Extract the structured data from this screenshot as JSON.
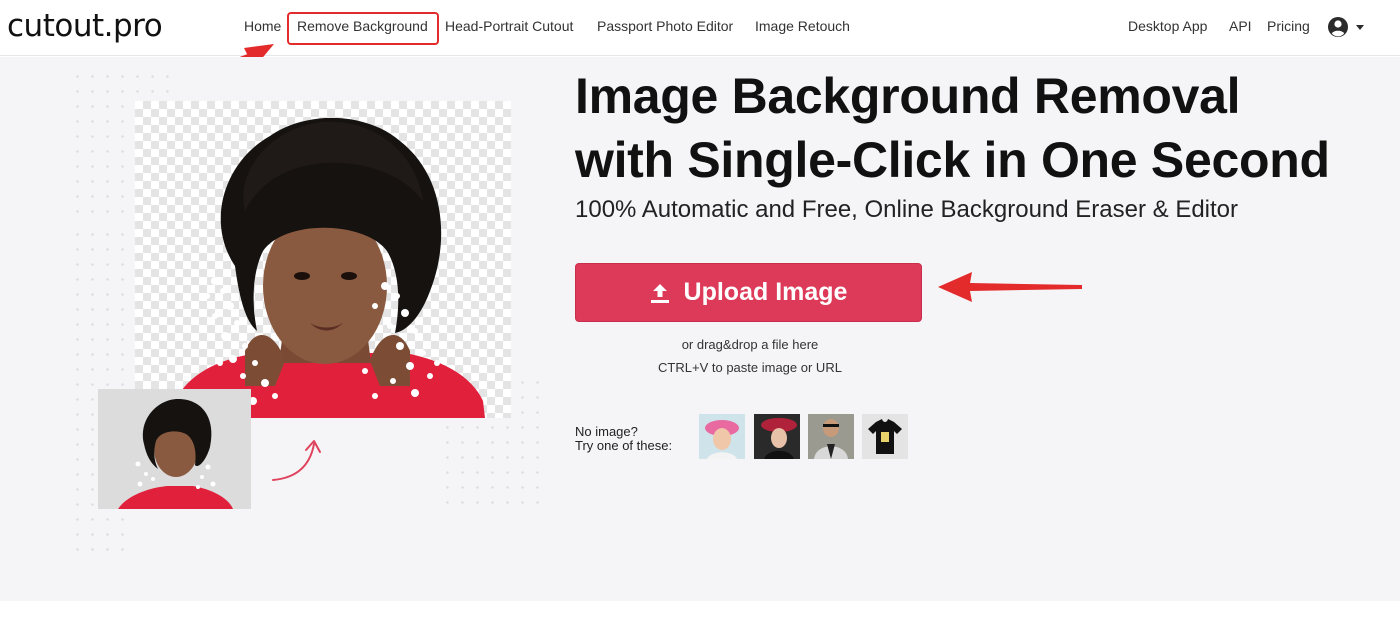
{
  "brand": {
    "logo": "cutout.pro"
  },
  "nav": {
    "links": [
      "Home",
      "Remove Background",
      "Head-Portrait Cutout",
      "Passport Photo Editor",
      "Image Retouch"
    ],
    "right": [
      "Desktop App",
      "API",
      "Pricing"
    ],
    "account_icon": "user-circle-icon",
    "dropdown_icon": "caret-down-icon"
  },
  "hero": {
    "title_line1": "Image Background Removal",
    "title_line2": "with Single-Click in One Second",
    "subtitle": "100% Automatic and Free, Online Background Eraser & Editor",
    "upload_label": "Upload Image",
    "upload_icon": "upload-arrow-icon",
    "hint_drag": "or drag&drop a file here",
    "hint_paste": "CTRL+V to paste image or URL",
    "no_image_line1": "No image?",
    "no_image_line2": "Try one of these:",
    "samples": [
      "child-in-pink-hat",
      "woman-in-red-hat",
      "man-in-suit",
      "black-t-shirt"
    ]
  },
  "colors": {
    "accent": "#dc3a58",
    "annotation": "#e32b2b",
    "hero_bg": "#f5f5f8"
  }
}
